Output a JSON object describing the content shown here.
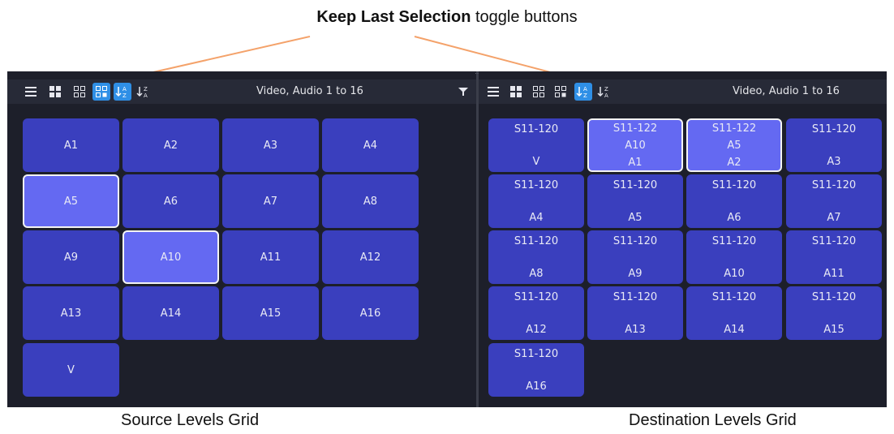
{
  "callout": {
    "bold": "Keep Last Selection",
    "rest": " toggle buttons"
  },
  "colors": {
    "panel_bg": "#1d1f2a",
    "toolbar_bg": "#272a37",
    "button": "#3a3fbe",
    "selected": "#6469f2",
    "active_toggle": "#2f8fe6",
    "leader": "#f4a26a"
  },
  "source": {
    "toolbar": {
      "icons": [
        "list-view-icon",
        "large-grid-icon",
        "small-grid-icon",
        "keep-last-selection-icon",
        "sort-ascending-icon",
        "sort-descending-icon"
      ],
      "level_filter": "Video, Audio 1 to 16"
    },
    "cells": [
      {
        "label": "A1",
        "selected": false
      },
      {
        "label": "A2",
        "selected": false
      },
      {
        "label": "A3",
        "selected": false
      },
      {
        "label": "A4",
        "selected": false
      },
      {
        "label": "A5",
        "selected": true
      },
      {
        "label": "A6",
        "selected": false
      },
      {
        "label": "A7",
        "selected": false
      },
      {
        "label": "A8",
        "selected": false
      },
      {
        "label": "A9",
        "selected": false
      },
      {
        "label": "A10",
        "selected": true
      },
      {
        "label": "A11",
        "selected": false
      },
      {
        "label": "A12",
        "selected": false
      },
      {
        "label": "A13",
        "selected": false
      },
      {
        "label": "A14",
        "selected": false
      },
      {
        "label": "A15",
        "selected": false
      },
      {
        "label": "A16",
        "selected": false
      },
      {
        "label": "V",
        "selected": false
      }
    ],
    "caption": "Source Levels Grid"
  },
  "destination": {
    "toolbar": {
      "icons": [
        "list-view-icon",
        "large-grid-icon",
        "small-grid-icon",
        "keep-last-selection-icon",
        "sort-ascending-icon",
        "sort-descending-icon"
      ],
      "level_filter": "Video, Audio 1 to 16"
    },
    "cells": [
      {
        "lines": [
          "S11-120",
          "V"
        ],
        "selected": false
      },
      {
        "lines": [
          "S11-122",
          "A10",
          "A1"
        ],
        "selected": true
      },
      {
        "lines": [
          "S11-122",
          "A5",
          "A2"
        ],
        "selected": true
      },
      {
        "lines": [
          "S11-120",
          "A3"
        ],
        "selected": false
      },
      {
        "lines": [
          "S11-120",
          "A4"
        ],
        "selected": false
      },
      {
        "lines": [
          "S11-120",
          "A5"
        ],
        "selected": false
      },
      {
        "lines": [
          "S11-120",
          "A6"
        ],
        "selected": false
      },
      {
        "lines": [
          "S11-120",
          "A7"
        ],
        "selected": false
      },
      {
        "lines": [
          "S11-120",
          "A8"
        ],
        "selected": false
      },
      {
        "lines": [
          "S11-120",
          "A9"
        ],
        "selected": false
      },
      {
        "lines": [
          "S11-120",
          "A10"
        ],
        "selected": false
      },
      {
        "lines": [
          "S11-120",
          "A11"
        ],
        "selected": false
      },
      {
        "lines": [
          "S11-120",
          "A12"
        ],
        "selected": false
      },
      {
        "lines": [
          "S11-120",
          "A13"
        ],
        "selected": false
      },
      {
        "lines": [
          "S11-120",
          "A14"
        ],
        "selected": false
      },
      {
        "lines": [
          "S11-120",
          "A15"
        ],
        "selected": false
      },
      {
        "lines": [
          "S11-120",
          "A16"
        ],
        "selected": false
      }
    ],
    "caption": "Destination Levels Grid"
  }
}
